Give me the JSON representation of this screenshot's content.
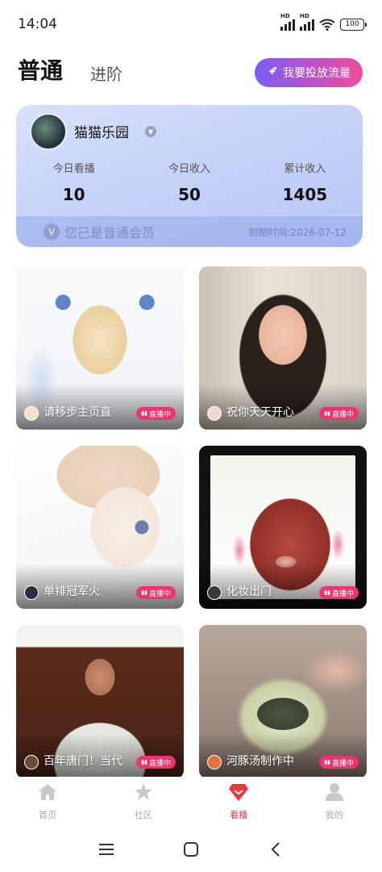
{
  "status_bar": {
    "time": "14:04",
    "battery": "100",
    "signal_label": "HD"
  },
  "header": {
    "tab_normal": "普通",
    "tab_advanced": "进阶",
    "promo_button": "我要投放流量"
  },
  "account": {
    "nickname": "猫猫乐园",
    "stats": [
      {
        "label": "今日看播",
        "value": "10"
      },
      {
        "label": "今日收入",
        "value": "50"
      },
      {
        "label": "累计收入",
        "value": "1405"
      }
    ],
    "membership_text": "您已是普通会员",
    "expire_text": "到期时间:2026-07-12"
  },
  "live_badge": "直播中",
  "rooms": [
    {
      "title": "请移步主页直"
    },
    {
      "title": "祝你天天开心"
    },
    {
      "title": "单排冠军火"
    },
    {
      "title": "化妆出门"
    },
    {
      "title": "百年唐门！当代"
    },
    {
      "title": "河豚汤制作中"
    }
  ],
  "bottom_nav": [
    {
      "label": "首页",
      "icon": "home-icon"
    },
    {
      "label": "社区",
      "icon": "star-icon"
    },
    {
      "label": "看播",
      "icon": "diamond-icon"
    },
    {
      "label": "我的",
      "icon": "person-icon"
    }
  ],
  "colors": {
    "accent_red": "#e8383d",
    "live_pink": "#f0336f",
    "promo_start": "#7b5cf5",
    "promo_end": "#ee4d9a"
  }
}
